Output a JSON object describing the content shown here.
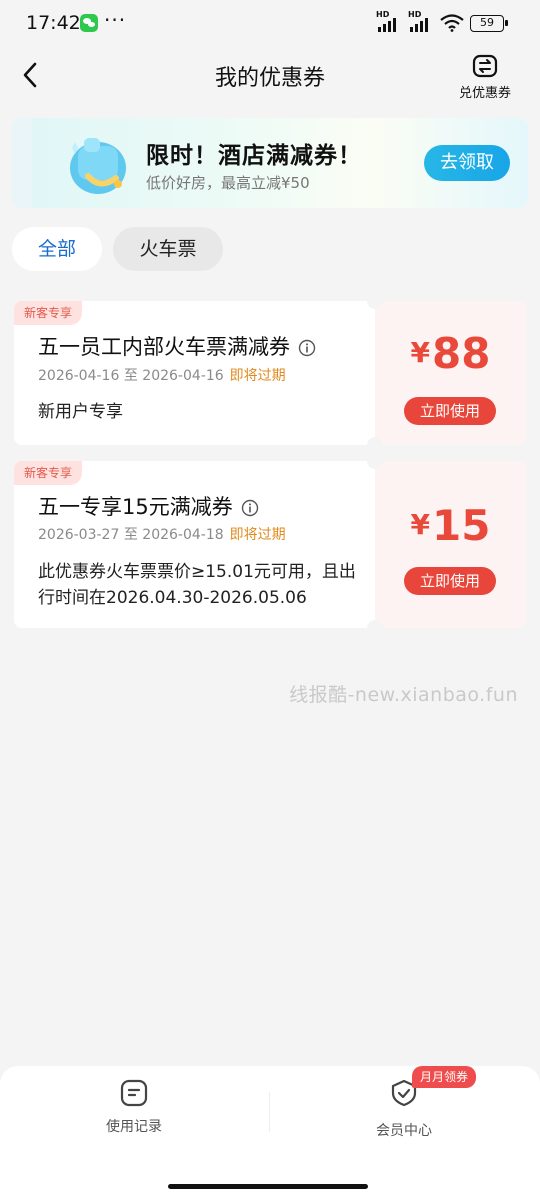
{
  "status_bar": {
    "time": "17:42",
    "more": "···",
    "battery": "59",
    "signal_label": "HD"
  },
  "header": {
    "title": "我的优惠券",
    "redeem_label": "兑优惠券"
  },
  "banner": {
    "title": "限时！酒店满减券！",
    "subtitle": "低价好房，最高立减¥50",
    "button": "去领取"
  },
  "tabs": [
    {
      "label": "全部",
      "active": true
    },
    {
      "label": "火车票",
      "active": false
    }
  ],
  "coupons": [
    {
      "badge": "新客专享",
      "title": "五一员工内部火车票满减券",
      "date_start": "2026-04-16",
      "date_sep": "至",
      "date_end": "2026-04-16",
      "expiry": "即将过期",
      "desc": "新用户专享",
      "currency": "¥",
      "amount": "88",
      "button": "立即使用"
    },
    {
      "badge": "新客专享",
      "title": "五一专享15元满减券",
      "date_start": "2026-03-27",
      "date_sep": "至",
      "date_end": "2026-04-18",
      "expiry": "即将过期",
      "desc": "此优惠券火车票票价≥15.01元可用，且出行时间在2026.04.30-2026.05.06",
      "currency": "¥",
      "amount": "15",
      "button": "立即使用"
    }
  ],
  "watermark": "线报酷-new.xianbao.fun",
  "bottom_nav": {
    "left_label": "使用记录",
    "right_label": "会员中心",
    "right_badge": "月月领券"
  },
  "colors": {
    "accent_blue": "#1a6ccc",
    "price_red": "#e8493a",
    "expiry_orange": "#e08a1e",
    "banner_button": "#18a5e8"
  }
}
